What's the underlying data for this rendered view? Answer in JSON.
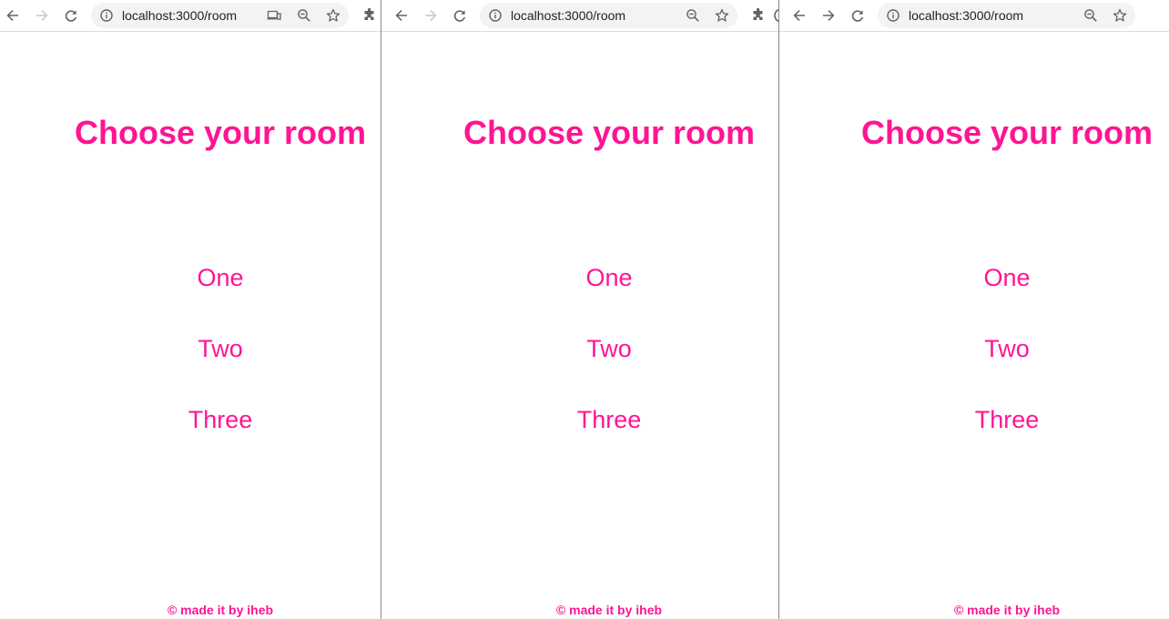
{
  "browser": {
    "url": "localhost:3000/room",
    "icons": {
      "back": "arrow-left-icon",
      "forward": "arrow-right-icon",
      "reload": "reload-icon",
      "info": "info-icon",
      "cast": "cast-icon",
      "zoom": "zoom-icon",
      "bookmark": "star-icon",
      "extensions": "puzzle-icon"
    },
    "colors": {
      "icon": "#5f6368",
      "icon_disabled": "#c4c7ca",
      "omnibox": "#f1f3f4"
    }
  },
  "page": {
    "title": "Choose your room",
    "rooms": [
      {
        "label": "One"
      },
      {
        "label": "Two"
      },
      {
        "label": "Three"
      }
    ],
    "footer": "© made it by iheb",
    "colors": {
      "accent": "#ff1493",
      "background": "#ffffff"
    }
  }
}
